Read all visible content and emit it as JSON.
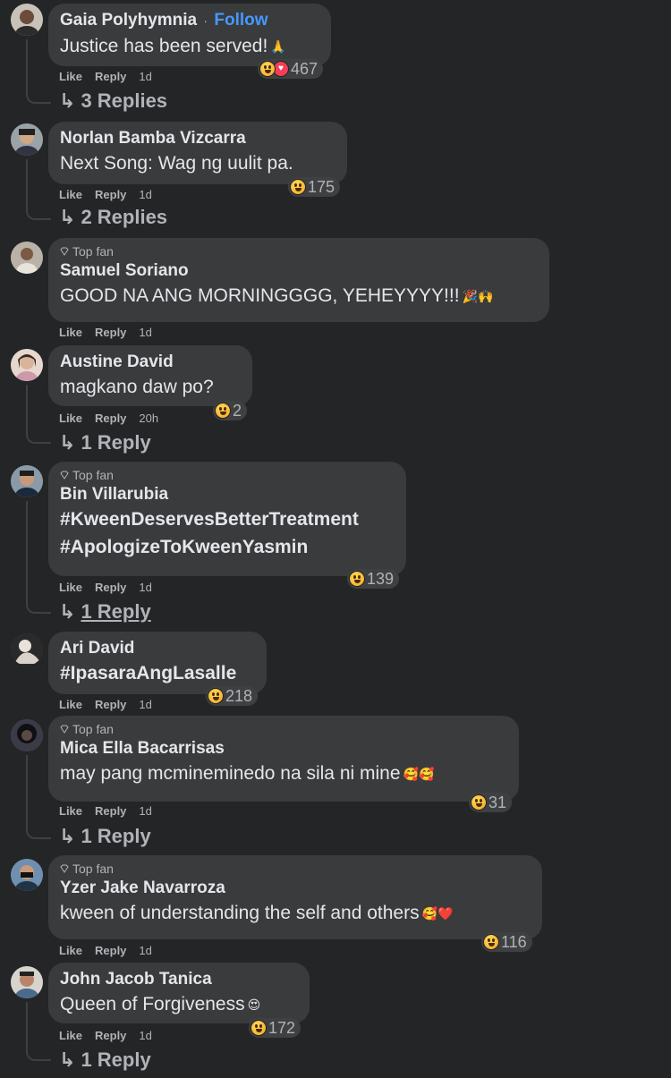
{
  "comments": [
    {
      "name": "Gaia Polyhymnia",
      "follow": "Follow",
      "badge": "",
      "text": "Justice has been served!",
      "emoji": "🙏",
      "reaction_count": "467",
      "like": "Like",
      "reply": "Reply",
      "time": "1d",
      "replies": "3 Replies"
    },
    {
      "name": "Norlan Bamba Vizcarra",
      "badge": "",
      "text": "Next Song: Wag ng uulit pa.",
      "emoji": "",
      "reaction_count": "175",
      "like": "Like",
      "reply": "Reply",
      "time": "1d",
      "replies": "2 Replies"
    },
    {
      "name": "Samuel Soriano",
      "badge": "Top fan",
      "text": "GOOD NA ANG MORNINGGGG, YEHEYYYY!!!",
      "emoji": "🎉🙌",
      "reaction_count": "",
      "like": "Like",
      "reply": "Reply",
      "time": "1d",
      "replies": ""
    },
    {
      "name": "Austine David",
      "badge": "",
      "text": "magkano daw po?",
      "emoji": "",
      "reaction_count": "2",
      "like": "Like",
      "reply": "Reply",
      "time": "20h",
      "replies": "1 Reply"
    },
    {
      "name": "Bin Villarubia",
      "badge": "Top fan",
      "text": "#KweenDeservesBetterTreatment",
      "text2": "#ApologizeToKweenYasmin",
      "emoji": "",
      "reaction_count": "139",
      "like": "Like",
      "reply": "Reply",
      "time": "1d",
      "replies": "1 Reply"
    },
    {
      "name": "Ari David",
      "badge": "",
      "text": "#IpasaraAngLasalle",
      "emoji": "",
      "reaction_count": "218",
      "like": "Like",
      "reply": "Reply",
      "time": "1d",
      "replies": ""
    },
    {
      "name": "Mica Ella Bacarrisas",
      "badge": "Top fan",
      "text": "may pang mcmineminedo na sila ni mine",
      "emoji": "🥰🥰",
      "reaction_count": "31",
      "like": "Like",
      "reply": "Reply",
      "time": "1d",
      "replies": "1 Reply"
    },
    {
      "name": "Yzer Jake Navarroza",
      "badge": "Top fan",
      "text": "kween of understanding the self and others",
      "emoji": "🥰❤️",
      "reaction_count": "116",
      "like": "Like",
      "reply": "Reply",
      "time": "1d",
      "replies": ""
    },
    {
      "name": "John Jacob Tanica",
      "badge": "",
      "text": "Queen of Forgiveness",
      "emoji": "😍",
      "reaction_count": "172",
      "like": "Like",
      "reply": "Reply",
      "time": "1d",
      "replies": "1 Reply"
    }
  ],
  "colors": {
    "background": "#242526",
    "bubble": "#3a3b3c",
    "follow": "#4599ff",
    "secondary": "#b0b3b8"
  },
  "icons": {
    "reply_arrow": "reply-arrow-icon",
    "gem": "top-fan-gem-icon",
    "haha": "haha-reaction-icon",
    "love": "love-reaction-icon"
  }
}
